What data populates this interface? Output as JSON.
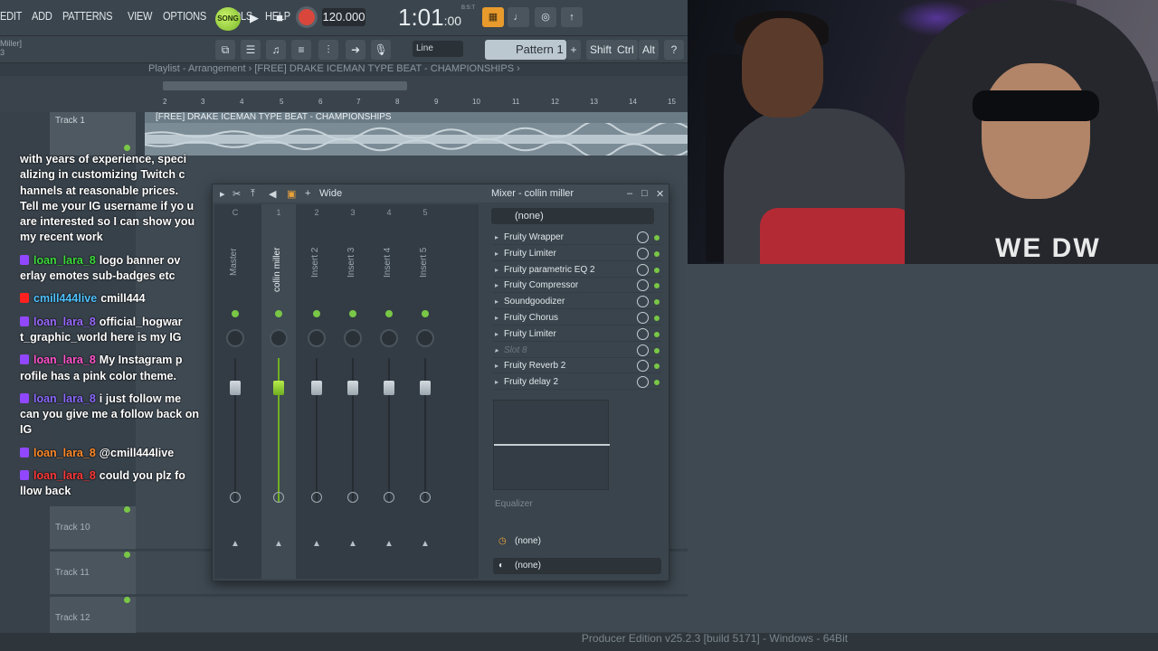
{
  "menu": [
    "EDIT",
    "ADD",
    "PATTERNS",
    "VIEW",
    "OPTIONS",
    "TOOLS",
    "HELP"
  ],
  "transport": {
    "song_label": "SONG",
    "tempo": "120.000",
    "time": "1:01",
    "time_sub": ":00",
    "sig": "B:S:T"
  },
  "toolbar2": {
    "project_name": "Miller]",
    "project_sub": "3",
    "snap": "Line",
    "pattern": "Pattern 1",
    "keys": [
      "Shift",
      "Ctrl",
      "Alt"
    ]
  },
  "playlist": {
    "breadcrumb": "Playlist - Arrangement › [FREE] DRAKE ICEMAN TYPE BEAT - CHAMPIONSHIPS ›",
    "ruler": [
      "2",
      "3",
      "4",
      "5",
      "6",
      "7",
      "8",
      "9",
      "10",
      "11",
      "12",
      "13",
      "14",
      "15"
    ],
    "clip_title": "[FREE] DRAKE ICEMAN TYPE BEAT - CHAMPIONSHIPS",
    "tracks": [
      "Track 1",
      "Track 10",
      "Track 11",
      "Track 12"
    ]
  },
  "chat": [
    {
      "user": "",
      "color": "#ffffff",
      "badge": "",
      "text": "with years of experience, speci alizing in customizing Twitch c hannels at reasonable prices. Tell me your IG username if yo u are interested so I can show you my recent work"
    },
    {
      "user": "loan_lara_8",
      "color": "#3ddc3d",
      "badge": "twitch",
      "text": "logo banner ov erlay emotes sub-badges etc"
    },
    {
      "user": "cmill444live",
      "color": "#4fc3ff",
      "badge": "yt",
      "text": "cmill444"
    },
    {
      "user": "loan_lara_8",
      "color": "#9b6bff",
      "badge": "twitch",
      "text": "official_hogwar t_graphic_world here is my IG"
    },
    {
      "user": "loan_lara_8",
      "color": "#ff55cc",
      "badge": "twitch",
      "text": "My Instagram p rofile has a pink color theme."
    },
    {
      "user": "loan_lara_8",
      "color": "#8b6bff",
      "badge": "twitch",
      "text": "i just follow me can you give me a follow back on IG"
    },
    {
      "user": "loan_lara_8",
      "color": "#ff8a2a",
      "badge": "twitch",
      "text": "@cmill444live"
    },
    {
      "user": "loan_lara_8",
      "color": "#ff3a3a",
      "badge": "twitch",
      "text": "could you plz fo llow back"
    }
  ],
  "mixer": {
    "title": "Mixer - collin miller",
    "mode": "Wide",
    "strips": [
      {
        "num": "C",
        "label": "Master"
      },
      {
        "num": "1",
        "label": "collin miller"
      },
      {
        "num": "2",
        "label": "Insert 2"
      },
      {
        "num": "3",
        "label": "Insert 3"
      },
      {
        "num": "4",
        "label": "Insert 4"
      },
      {
        "num": "5",
        "label": "Insert 5"
      }
    ],
    "preset": "(none)",
    "fx_slots": [
      {
        "name": "Fruity Wrapper",
        "empty": false
      },
      {
        "name": "Fruity Limiter",
        "empty": false
      },
      {
        "name": "Fruity parametric EQ 2",
        "empty": false
      },
      {
        "name": "Fruity Compressor",
        "empty": false
      },
      {
        "name": "Soundgoodizer",
        "empty": false
      },
      {
        "name": "Fruity Chorus",
        "empty": false
      },
      {
        "name": "Fruity Limiter",
        "empty": false
      },
      {
        "name": "Slot 8",
        "empty": true
      },
      {
        "name": "Fruity Reverb 2",
        "empty": false
      },
      {
        "name": "Fruity delay 2",
        "empty": false
      }
    ],
    "eq_label": "Equalizer",
    "route_in": "(none)",
    "route_out": "(none)"
  },
  "webcam": {
    "shirt_text": "WE DW"
  },
  "status": "Producer Edition v25.2.3 [build 5171] - Windows - 64Bit"
}
